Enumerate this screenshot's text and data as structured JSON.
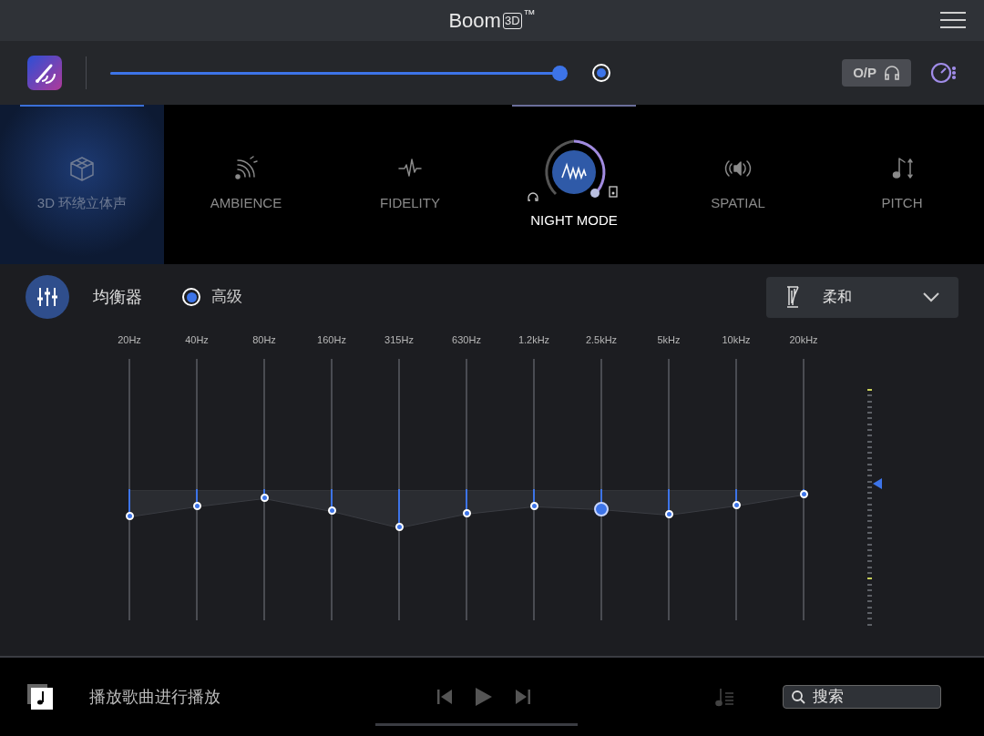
{
  "title_bar": {
    "title": "Boom",
    "badge": "3D",
    "mark": "™"
  },
  "toolbar": {
    "volume": {
      "level": 1.0
    },
    "output_button": "O/P"
  },
  "effects": [
    {
      "kind": "cube",
      "label": "3D 环绕立体声",
      "selected": true,
      "active": false
    },
    {
      "kind": "ambience",
      "label": "AMBIENCE",
      "selected": false,
      "active": false
    },
    {
      "kind": "fidelity",
      "label": "FIDELITY",
      "selected": false,
      "active": false
    },
    {
      "kind": "night",
      "label": "NIGHT MODE",
      "selected": false,
      "active": true
    },
    {
      "kind": "spatial",
      "label": "SPATIAL",
      "selected": false,
      "active": false
    },
    {
      "kind": "pitch",
      "label": "PITCH",
      "selected": false,
      "active": false
    }
  ],
  "equalizer": {
    "title": "均衡器",
    "advanced": {
      "label": "高级",
      "checked": true
    },
    "preset": "柔和",
    "bands": [
      {
        "label": "20Hz",
        "level": 0.397,
        "selected": false
      },
      {
        "label": "40Hz",
        "level": 0.436,
        "selected": false
      },
      {
        "label": "80Hz",
        "level": 0.467,
        "selected": false
      },
      {
        "label": "160Hz",
        "level": 0.418,
        "selected": false
      },
      {
        "label": "315Hz",
        "level": 0.355,
        "selected": false
      },
      {
        "label": "630Hz",
        "level": 0.408,
        "selected": false
      },
      {
        "label": "1.2kHz",
        "level": 0.436,
        "selected": false
      },
      {
        "label": "2.5kHz",
        "level": 0.425,
        "selected": true
      },
      {
        "label": "5kHz",
        "level": 0.404,
        "selected": false
      },
      {
        "label": "10kHz",
        "level": 0.439,
        "selected": false
      },
      {
        "label": "20kHz",
        "level": 0.481,
        "selected": false
      }
    ],
    "output_meter": {
      "level": 0.6
    }
  },
  "player": {
    "message": "播放歌曲进行播放",
    "search": {
      "placeholder": "搜索"
    }
  }
}
